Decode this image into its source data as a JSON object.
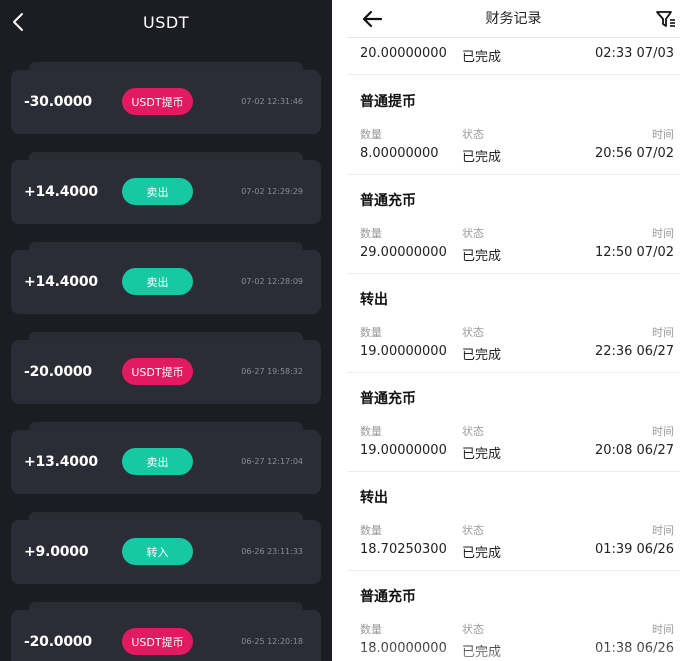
{
  "left": {
    "title": "USDT",
    "records": [
      {
        "amount": "-30.0000",
        "badge": "USDT提币",
        "badge_color": "#e21a5f",
        "time": "07-02 12:31:46"
      },
      {
        "amount": "+14.4000",
        "badge": "卖出",
        "badge_color": "#17c9a3",
        "time": "07-02 12:29:29"
      },
      {
        "amount": "+14.4000",
        "badge": "卖出",
        "badge_color": "#17c9a3",
        "time": "07-02 12:28:09"
      },
      {
        "amount": "-20.0000",
        "badge": "USDT提币",
        "badge_color": "#e21a5f",
        "time": "06-27 19:58:32"
      },
      {
        "amount": "+13.4000",
        "badge": "卖出",
        "badge_color": "#17c9a3",
        "time": "06-27 12:17:04"
      },
      {
        "amount": "+9.0000",
        "badge": "转入",
        "badge_color": "#17c9a3",
        "time": "06-26 23:11:33"
      },
      {
        "amount": "-20.0000",
        "badge": "USDT提币",
        "badge_color": "#e21a5f",
        "time": "06-25 12:20:18"
      }
    ]
  },
  "right": {
    "title": "财务记录",
    "top_partial": {
      "qty": "20.00000000",
      "status": "已完成",
      "time": "02:33 07/03"
    },
    "labels": {
      "qty": "数量",
      "status": "状态",
      "time": "时间"
    },
    "records": [
      {
        "type": "普通提币",
        "qty": "8.00000000",
        "status": "已完成",
        "time": "20:56 07/02"
      },
      {
        "type": "普通充币",
        "qty": "29.00000000",
        "status": "已完成",
        "time": "12:50 07/02"
      },
      {
        "type": "转出",
        "qty": "19.00000000",
        "status": "已完成",
        "time": "22:36 06/27"
      },
      {
        "type": "普通充币",
        "qty": "19.00000000",
        "status": "已完成",
        "time": "20:08 06/27"
      },
      {
        "type": "转出",
        "qty": "18.70250300",
        "status": "已完成",
        "time": "01:39 06/26"
      },
      {
        "type": "普通充币",
        "qty": "18.00000000",
        "status": "已完成",
        "time": "01:38 06/26"
      }
    ]
  },
  "colors": {
    "dark_bg": "#1c1d23",
    "card_bg": "#2b2c35",
    "pink": "#e21a5f",
    "teal": "#17c9a3"
  },
  "icons": {
    "left_back": "chevron-left-icon",
    "right_back": "arrow-left-icon",
    "filter": "filter-icon"
  }
}
